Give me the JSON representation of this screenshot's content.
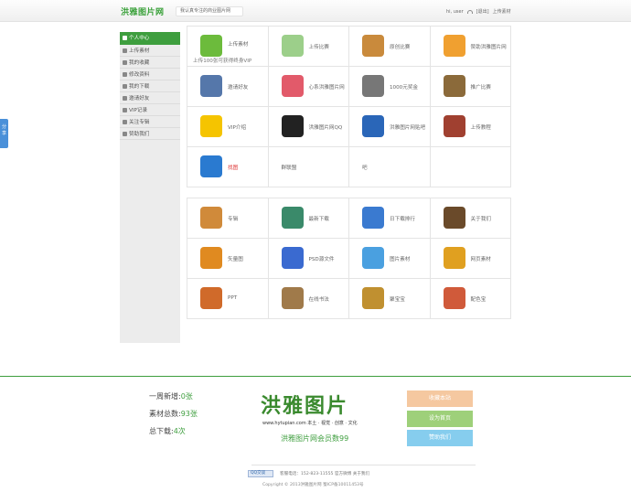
{
  "header": {
    "logo": "洪雅图片网",
    "slogan": "我认真专注的商业图片网",
    "user": "hi, user",
    "logout": "[退出]",
    "upload": "上传素材"
  },
  "share_tab": "分享",
  "sidebar": {
    "items": [
      {
        "label": "个人中心"
      },
      {
        "label": "上传素材"
      },
      {
        "label": "我的收藏"
      },
      {
        "label": "修改资料"
      },
      {
        "label": "我的下载"
      },
      {
        "label": "邀请好友"
      },
      {
        "label": "VIP记录"
      },
      {
        "label": "关注专辑"
      },
      {
        "label": "赞助我们"
      }
    ]
  },
  "grid1": [
    {
      "label": "上传素材",
      "sub": "上传100张可获得终身VIP",
      "icon": "upload-arrow-icon",
      "color": "#6cbb3c"
    },
    {
      "label": "上传比赛",
      "icon": "house-icon",
      "color": "#9ccf8a"
    },
    {
      "label": "原创比赛",
      "icon": "palette-icon",
      "color": "#c98a3c"
    },
    {
      "label": "赞助洪雅图片网",
      "icon": "money-bag-icon",
      "color": "#f0a030"
    },
    {
      "label": "邀请好友",
      "icon": "chat-users-icon",
      "color": "#5577aa"
    },
    {
      "label": "心系洪雅图片网",
      "icon": "heart-icon",
      "color": "#e25a6a"
    },
    {
      "label": "1000元奖金",
      "icon": "pk-icon",
      "color": "#777777"
    },
    {
      "label": "推广比赛",
      "icon": "camera-icon",
      "color": "#8b6a3a"
    },
    {
      "label": "VIP介绍",
      "icon": "crown-icon",
      "color": "#f5c400"
    },
    {
      "label": "洪雅图片网QQ",
      "icon": "penguin-icon",
      "color": "#222222"
    },
    {
      "label": "洪雅图片网贴吧",
      "icon": "tieba-icon",
      "color": "#2a66b8"
    },
    {
      "label": "上传教程",
      "icon": "books-icon",
      "color": "#a04030"
    },
    {
      "label": "找图",
      "icon": "search-icon",
      "color": "#2a7ad0"
    },
    {
      "label": "群联盟",
      "icon": "",
      "color": ""
    },
    {
      "label": "吧",
      "icon": "",
      "color": ""
    },
    {
      "label": "",
      "icon": "",
      "color": ""
    }
  ],
  "grid2": [
    {
      "label": "专辑",
      "icon": "album-icon",
      "color": "#d08a3a"
    },
    {
      "label": "最新下载",
      "icon": "download-clock-icon",
      "color": "#3a8a6a"
    },
    {
      "label": "日下载排行",
      "icon": "bar-chart-icon",
      "color": "#3a7ad0"
    },
    {
      "label": "关于我们",
      "icon": "people-icon",
      "color": "#6a4a2a"
    },
    {
      "label": "矢量图",
      "icon": "vector-file-icon",
      "color": "#e08a20"
    },
    {
      "label": "PSD源文件",
      "icon": "psd-file-icon",
      "color": "#3a6ad0"
    },
    {
      "label": "图片素材",
      "icon": "monitor-icon",
      "color": "#4aa0e0"
    },
    {
      "label": "网页素材",
      "icon": "globe-folder-icon",
      "color": "#e0a020"
    },
    {
      "label": "PPT",
      "icon": "ppt-icon",
      "color": "#d06a2a"
    },
    {
      "label": "在线书法",
      "icon": "pen-paper-icon",
      "color": "#a07a4a"
    },
    {
      "label": "聚宝宝",
      "icon": "treasure-chest-icon",
      "color": "#c09030"
    },
    {
      "label": "配色宝",
      "icon": "color-palette-icon",
      "color": "#d05a3a"
    }
  ],
  "footer": {
    "stat_week_label": "一周新增:",
    "stat_week_value": "0张",
    "stat_total_label": "素材总数:",
    "stat_total_value": "93张",
    "stat_download_label": "总下载:",
    "stat_download_value": "4次",
    "banner_title": "洪雅图片",
    "banner_url": "www.hytupian.com  本土 · 视觉 · 创意 · 文化",
    "banner_members": "洪雅图片网会员数99",
    "btn_favorite": "收藏本站",
    "btn_homepage": "设为首页",
    "btn_sponsor": "赞助我们",
    "qq_label": "QQ交谈",
    "contact": "客服电话：152-823-11555   官方微博   关于我们",
    "copyright": "Copyright © 2013洪雅图片网 蜀ICP备10011453号"
  }
}
